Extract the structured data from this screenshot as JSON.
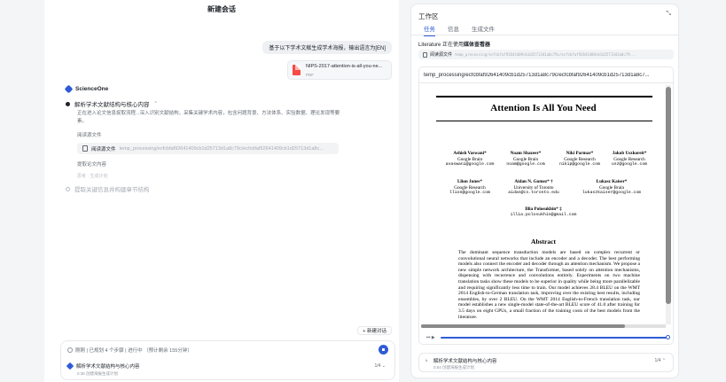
{
  "chat": {
    "title": "新建会话",
    "user_message": "基于以下学术文献生成学术海报，输出语言为[EN]",
    "file": {
      "name": "NIPS-2017-attention-is-all-you-ne...",
      "type": "PDF"
    },
    "brand": "ScienceOne",
    "step1": {
      "title": "解析学术文献结构与核心内容",
      "caret": "⌃",
      "description": "正在进入论文信息捉取流程...深入识别文献结构，采集关键学术内容，包含问题背景、方法体系、实验数据、理论发现等要素。",
      "read_label": "阅读源文件",
      "tool_name": "阅读源文件",
      "tool_path": "temp_processing/ecfcbfaf92641409cb1d25713d1a8c79c/ecfcbfaf92641409cb1d25713d1a8c...",
      "extract_label": "提取论文内容",
      "muted": "思考  ·  生成计划"
    },
    "step2": {
      "title": "提取关键信息并构建章节结构"
    },
    "new_chat_label": "+ 新建对话",
    "status": {
      "line": "刚刚 | 已规划 4 个步骤 | 进行中 （预计剩余 155分钟）",
      "task_title": "解析学术文献结构与核心内容",
      "task_sub": "0:35  创建海报生成计划",
      "task_count": "1/4  ⌄"
    }
  },
  "workspace": {
    "title": "工作区",
    "close_glyph": "⤡",
    "tabs": [
      "任务",
      "信息",
      "生成文件"
    ],
    "viewer_note_prefix": "Literature 正在使用",
    "viewer_note_bold": "媒体查看器",
    "path_chip_label": "阅读源文件",
    "path_chip_path": "temp_processing/ecfcbfaf92641409cb1d25713d1a8c79c/ecfcbfaf92641409cb1d25713d1a8c79...",
    "doc_path": "temp_processing/ecfcbfaf92641409cb1d25713d1a8c79c/ecfcbfaf92641409cb1d25713d1a8c7...",
    "paper": {
      "title": "Attention Is All You Need",
      "authors_row1": [
        {
          "name": "Ashish Vaswani*",
          "org": "Google Brain",
          "email": "avaswani@google.com"
        },
        {
          "name": "Noam Shazeer*",
          "org": "Google Brain",
          "email": "noam@google.com"
        },
        {
          "name": "Niki Parmar*",
          "org": "Google Research",
          "email": "nikip@google.com"
        },
        {
          "name": "Jakob Uszkoreit*",
          "org": "Google Research",
          "email": "usz@google.com"
        }
      ],
      "authors_row2": [
        {
          "name": "Llion Jones*",
          "org": "Google Research",
          "email": "llion@google.com"
        },
        {
          "name": "Aidan N. Gomez* †",
          "org": "University of Toronto",
          "email": "aidan@cs.toronto.edu"
        },
        {
          "name": "Łukasz Kaiser*",
          "org": "Google Brain",
          "email": "lukaszkaiser@google.com"
        }
      ],
      "authors_row3": [
        {
          "name": "Illia Polosukhin* ‡",
          "org": "",
          "email": "illia.polosukhin@gmail.com"
        }
      ],
      "abstract_title": "Abstract",
      "abstract": "The dominant sequence transduction models are based on complex recurrent or convolutional neural networks that include an encoder and a decoder. The best performing models also connect the encoder and decoder through an attention mechanism. We propose a new simple network architecture, the Transformer, based solely on attention mechanisms, dispensing with recurrence and convolutions entirely. Experiments on two machine translation tasks show these models to be superior in quality while being more parallelizable and requiring significantly less time to train. Our model achieves 28.4 BLEU on the WMT 2014 English-to-German translation task, improving over the existing best results, including ensembles, by over 2 BLEU. On the WMT 2014 English-to-French translation task, our model establishes a new single-model state-of-the-art BLEU score of 41.0 after training for 3.5 days on eight GPUs, a small fraction of the training costs of the best models from the literature."
    },
    "player_controls": "⏮  ▶",
    "player_progress": 1.0,
    "task": {
      "title": "解析学术文献结构与核心内容",
      "sub": "0:54  创建海报生成计划",
      "count": "1/4  ⌃"
    }
  }
}
